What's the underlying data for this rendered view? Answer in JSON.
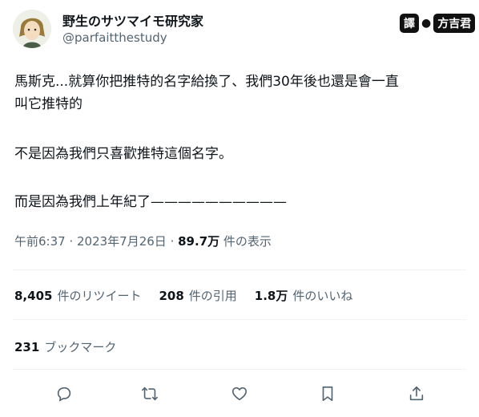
{
  "author": {
    "display_name": "野生のサツマイモ研究家",
    "handle": "@parfaitthestudy"
  },
  "translator_badge": {
    "prefix": "譯",
    "name": "方吉君"
  },
  "tweet": {
    "lines": [
      "馬斯克...就算你把推特的名字給換了、我們30年後也還是會一直",
      "叫它推特的",
      "不是因為我們只喜歡推特這個名字。",
      "而是因為我們上年紀了——————————"
    ]
  },
  "meta": {
    "time": "午前6:37",
    "sep1": " · ",
    "date": "2023年7月26日",
    "sep2": " · ",
    "views": "89.7万",
    "views_label": "件の表示"
  },
  "stats": [
    {
      "count": "8,405",
      "label": "件のリツイート"
    },
    {
      "count": "208",
      "label": "件の引用"
    },
    {
      "count": "1.8万",
      "label": "件のいいね"
    }
  ],
  "bookmarks": {
    "count": "231",
    "label": "ブックマーク"
  },
  "actions": [
    "reply-icon",
    "retweet-icon",
    "like-icon",
    "bookmark-icon",
    "share-icon"
  ],
  "colors": {
    "text": "#0f1419",
    "secondary": "#536471",
    "divider": "#eff3f4"
  }
}
